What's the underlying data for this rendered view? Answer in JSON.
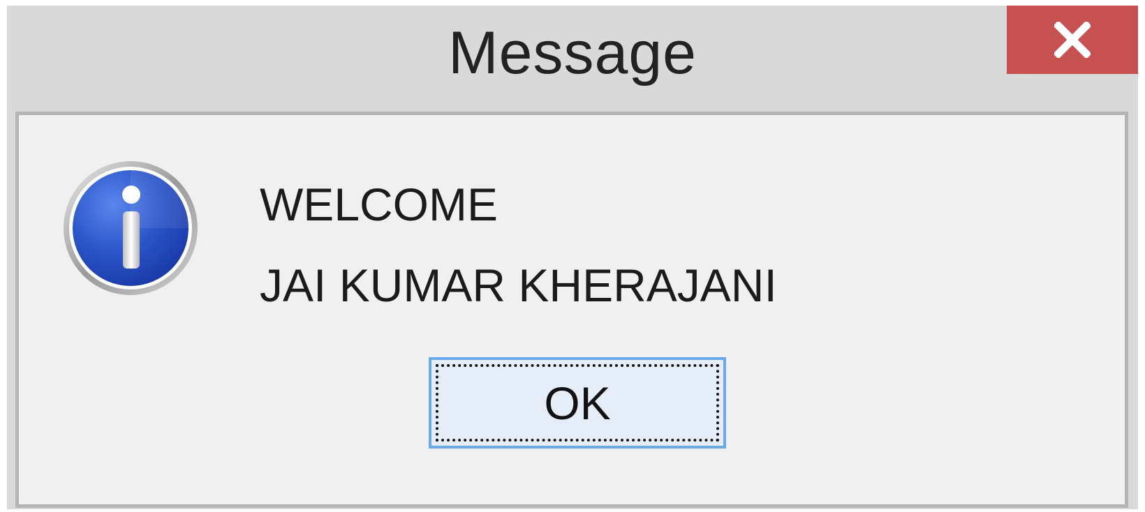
{
  "window": {
    "title": "Message",
    "close_icon": "close-icon"
  },
  "dialog": {
    "icon": "info-icon",
    "message_line_1": "WELCOME",
    "message_line_2": "JAI KUMAR KHERAJANI",
    "ok_label": "OK"
  },
  "colors": {
    "close_button": "#c75050",
    "ok_border": "#6aa9ea",
    "icon_blue": "#1e4fc2"
  }
}
